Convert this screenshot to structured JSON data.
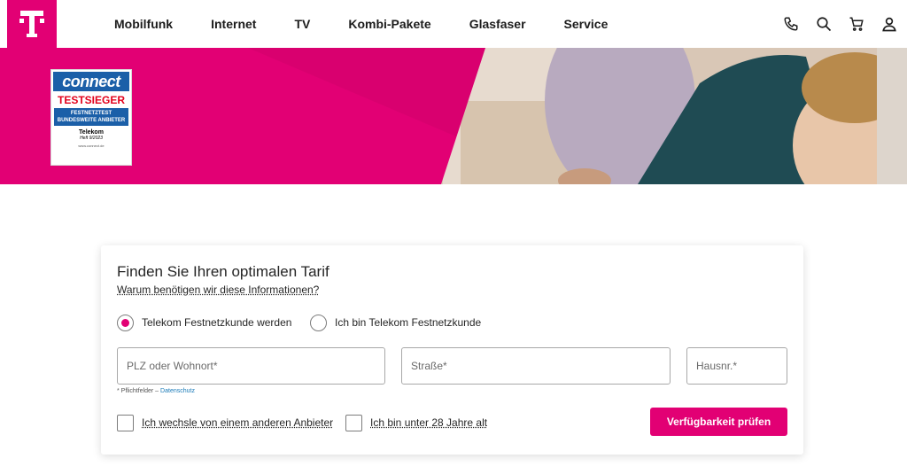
{
  "header": {
    "logo": "T",
    "nav": [
      "Mobilfunk",
      "Internet",
      "TV",
      "Kombi-Pakete",
      "Glasfaser",
      "Service"
    ],
    "icons": [
      "phone-icon",
      "search-icon",
      "cart-icon",
      "user-icon"
    ]
  },
  "hero": {
    "badge": {
      "brand": "connect",
      "award": "TESTSIEGER",
      "line1": "FESTNETZTEST",
      "line2": "BUNDESWEITE ANBIETER",
      "company": "Telekom",
      "issue": "Heft 9/2023",
      "url": "www.connect.de"
    }
  },
  "form": {
    "title": "Finden Sie Ihren optimalen Tarif",
    "info_link": "Warum benötigen wir diese Informationen?",
    "radio_new": "Telekom Festnetzkunde werden",
    "radio_existing": "Ich bin Telekom Festnetzkunde",
    "radio_selected": "new",
    "plz_placeholder": "PLZ oder Wohnort*",
    "street_placeholder": "Straße*",
    "house_placeholder": "Hausnr.*",
    "required_hint": "* Pflichtfelder –",
    "privacy_link": "Datenschutz",
    "check_switch": "Ich wechsle von einem anderen Anbieter",
    "check_under28": "Ich bin unter 28 Jahre alt",
    "submit": "Verfügbarkeit prüfen"
  },
  "colors": {
    "brand": "#e20074"
  }
}
